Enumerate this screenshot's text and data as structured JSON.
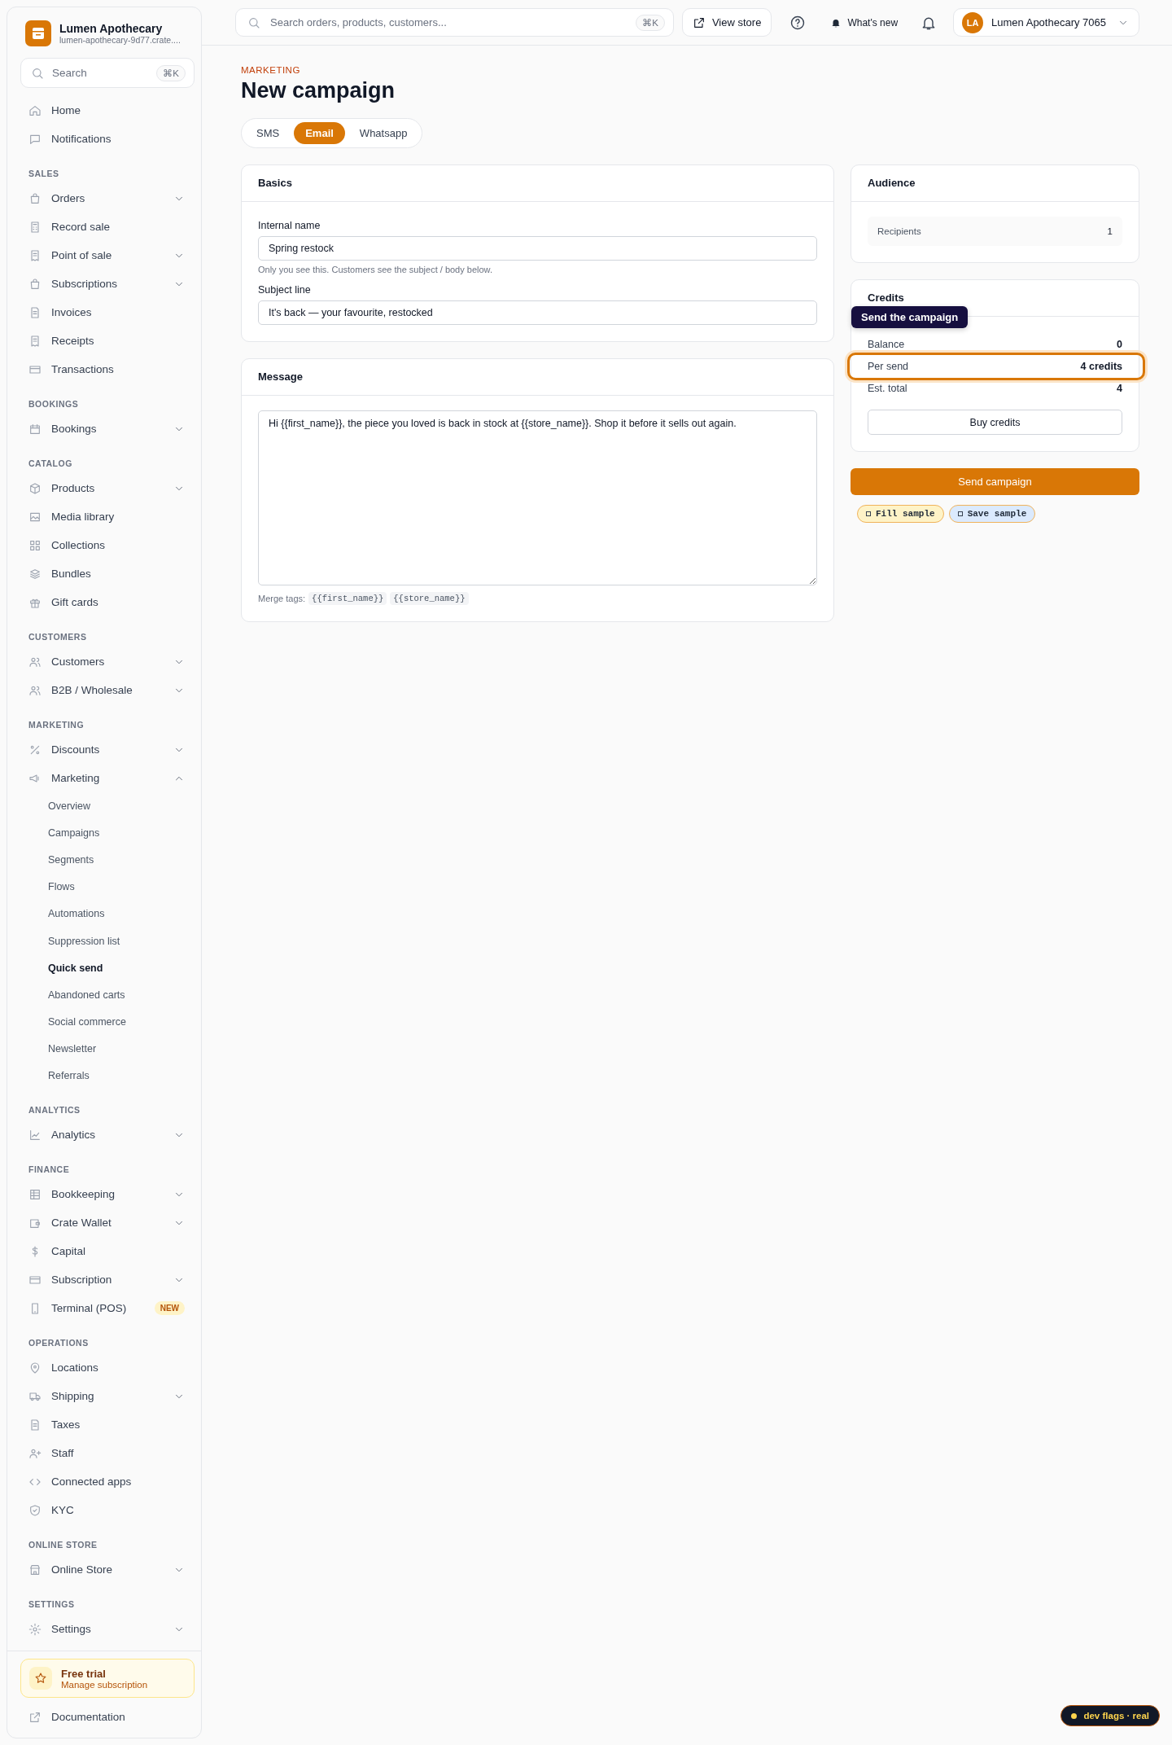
{
  "brand": {
    "name": "Lumen Apothecary",
    "domain": "lumen-apothecary-9d77.crate...."
  },
  "sidebar_search": {
    "placeholder": "Search",
    "shortcut": "⌘K"
  },
  "nav": [
    {
      "items": [
        {
          "label": "Home",
          "selected": false
        },
        {
          "label": "Notifications",
          "selected": false
        }
      ]
    },
    {
      "heading": "SALES",
      "items": [
        {
          "label": "Orders",
          "selected": false,
          "expanded": false
        },
        {
          "label": "Record sale",
          "selected": false
        },
        {
          "label": "Point of sale",
          "selected": false,
          "expanded": false
        },
        {
          "label": "Subscriptions",
          "selected": false,
          "expanded": false
        },
        {
          "label": "Invoices",
          "selected": false
        },
        {
          "label": "Receipts",
          "selected": false
        },
        {
          "label": "Transactions",
          "selected": false
        }
      ]
    },
    {
      "heading": "BOOKINGS",
      "items": [
        {
          "label": "Bookings",
          "selected": false,
          "expanded": false
        }
      ]
    },
    {
      "heading": "CATALOG",
      "items": [
        {
          "label": "Products",
          "selected": false,
          "expanded": false
        },
        {
          "label": "Media library",
          "selected": false
        },
        {
          "label": "Collections",
          "selected": false
        },
        {
          "label": "Bundles",
          "selected": false
        },
        {
          "label": "Gift cards",
          "selected": false
        }
      ]
    },
    {
      "heading": "CUSTOMERS",
      "items": [
        {
          "label": "Customers",
          "selected": false,
          "expanded": false
        },
        {
          "label": "B2B / Wholesale",
          "selected": false,
          "expanded": false
        }
      ]
    },
    {
      "heading": "MARKETING",
      "items": [
        {
          "label": "Discounts",
          "selected": false,
          "expanded": false
        },
        {
          "label": "Marketing",
          "selected": false,
          "expanded": true,
          "children": [
            {
              "label": "Overview",
              "selected": false
            },
            {
              "label": "Campaigns",
              "selected": false
            },
            {
              "label": "Segments",
              "selected": false
            },
            {
              "label": "Flows",
              "selected": false
            },
            {
              "label": "Automations",
              "selected": false
            },
            {
              "label": "Suppression list",
              "selected": false
            },
            {
              "label": "Quick send",
              "selected": true
            },
            {
              "label": "Abandoned carts",
              "selected": false
            },
            {
              "label": "Social commerce",
              "selected": false
            },
            {
              "label": "Newsletter",
              "selected": false
            },
            {
              "label": "Referrals",
              "selected": false
            }
          ]
        }
      ]
    },
    {
      "heading": "ANALYTICS",
      "items": [
        {
          "label": "Analytics",
          "selected": false,
          "expanded": false
        }
      ]
    },
    {
      "heading": "FINANCE",
      "items": [
        {
          "label": "Bookkeeping",
          "selected": false,
          "expanded": false
        },
        {
          "label": "Crate Wallet",
          "selected": false,
          "expanded": false
        },
        {
          "label": "Capital",
          "selected": false
        },
        {
          "label": "Subscription",
          "selected": false,
          "expanded": false
        },
        {
          "label": "Terminal (POS)",
          "selected": false,
          "badge": "NEW"
        }
      ]
    },
    {
      "heading": "OPERATIONS",
      "items": [
        {
          "label": "Locations",
          "selected": false
        },
        {
          "label": "Shipping",
          "selected": false,
          "expanded": false
        },
        {
          "label": "Taxes",
          "selected": false
        },
        {
          "label": "Staff",
          "selected": false
        },
        {
          "label": "Connected apps",
          "selected": false
        },
        {
          "label": "KYC",
          "selected": false
        }
      ]
    },
    {
      "heading": "ONLINE STORE",
      "items": [
        {
          "label": "Online Store",
          "selected": false,
          "expanded": false
        }
      ]
    },
    {
      "heading": "SETTINGS",
      "items": [
        {
          "label": "Settings",
          "selected": false,
          "expanded": false
        }
      ]
    }
  ],
  "free_trial": {
    "title": "Free trial",
    "link": "Manage subscription"
  },
  "documentation": "Documentation",
  "topbar": {
    "search": {
      "placeholder": "Search orders, products, customers...",
      "shortcut": "⌘K"
    },
    "view_store": "View store",
    "whats_new": "What's new",
    "account": {
      "initials": "LA",
      "name": "Lumen Apothecary 7065"
    }
  },
  "page": {
    "eyebrow": "MARKETING",
    "title": "New campaign"
  },
  "channel_tabs": [
    {
      "label": "SMS",
      "selected": false
    },
    {
      "label": "Email",
      "selected": true
    },
    {
      "label": "Whatsapp",
      "selected": false
    }
  ],
  "basics": {
    "title": "Basics",
    "fields": [
      {
        "label": "Internal name",
        "value": "Spring restock",
        "hint": "Only you see this. Customers see the subject / body below."
      },
      {
        "label": "Subject line",
        "value": "It's back — your favourite, restocked"
      }
    ]
  },
  "message": {
    "title": "Message",
    "body": "Hi {{first_name}}, the piece you loved is back in stock at {{store_name}}. Shop it before it sells out again.",
    "merge_label": "Merge tags:",
    "merge_tags": [
      "{{first_name}}",
      "{{store_name}}"
    ]
  },
  "audience": {
    "title": "Audience",
    "rows": [
      {
        "label": "Recipients",
        "value": "1"
      }
    ]
  },
  "credits": {
    "title": "Credits",
    "rows": [
      {
        "label": "Balance",
        "value": "0",
        "highlighted": false
      },
      {
        "label": "Per send",
        "value": "4 credits",
        "highlighted": true
      },
      {
        "label": "Est. total",
        "value": "4",
        "highlighted": false
      }
    ],
    "buy_button": "Buy credits"
  },
  "tooltip": "Send the campaign",
  "send_button": "Send campaign",
  "dev_chips": [
    {
      "label": "Fill sample",
      "color": "#fef3c7"
    },
    {
      "label": "Save sample",
      "color": "#dbeafe"
    }
  ],
  "dev_flags": "dev flags · real"
}
